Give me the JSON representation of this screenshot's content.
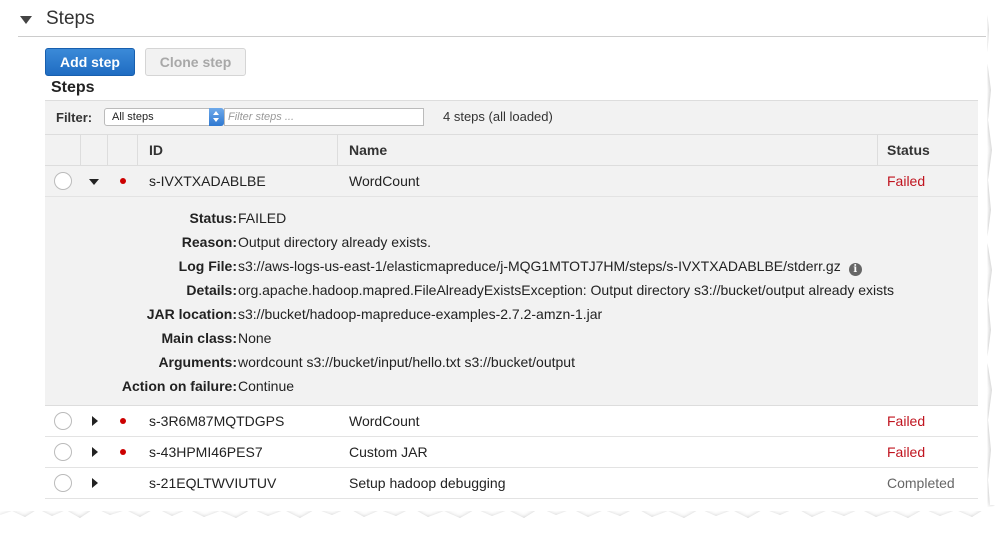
{
  "section": {
    "title": "Steps"
  },
  "toolbar": {
    "add_label": "Add step",
    "clone_label": "Clone step"
  },
  "steps_heading": "Steps",
  "filter": {
    "label": "Filter:",
    "selected": "All steps",
    "placeholder": "Filter steps ...",
    "count": "4 steps (all loaded)"
  },
  "columns": {
    "id": "ID",
    "name": "Name",
    "status": "Status"
  },
  "rows": [
    {
      "id": "s-IVXTXADABLBE",
      "name": "WordCount",
      "status": "Failed"
    },
    {
      "id": "s-3R6M87MQTDGPS",
      "name": "WordCount",
      "status": "Failed"
    },
    {
      "id": "s-43HPMI46PES7",
      "name": "Custom JAR",
      "status": "Failed"
    },
    {
      "id": "s-21EQLTWVIUTUV",
      "name": "Setup hadoop debugging",
      "status": "Completed"
    }
  ],
  "details": [
    {
      "key": "Status:",
      "value": "FAILED"
    },
    {
      "key": "Reason:",
      "value": "Output directory already exists."
    },
    {
      "key": "Log File:",
      "value": "s3://aws-logs-us-east-1/elasticmapreduce/j-MQG1MTOTJ7HM/steps/s-IVXTXADABLBE/stderr.gz"
    },
    {
      "key": "Details:",
      "value": "org.apache.hadoop.mapred.FileAlreadyExistsException: Output directory s3://bucket/output already exists"
    },
    {
      "key": "JAR location:",
      "value": "s3://bucket/hadoop-mapreduce-examples-2.7.2-amzn-1.jar"
    },
    {
      "key": "Main class:",
      "value": "None"
    },
    {
      "key": "Arguments:",
      "value": "wordcount s3://bucket/input/hello.txt s3://bucket/output"
    },
    {
      "key": "Action on failure:",
      "value": "Continue"
    }
  ],
  "icons": {
    "info": "i"
  },
  "colors": {
    "failed": "#c0141f",
    "primary": "#1f6cc2",
    "error_dot": "#cc0000"
  }
}
